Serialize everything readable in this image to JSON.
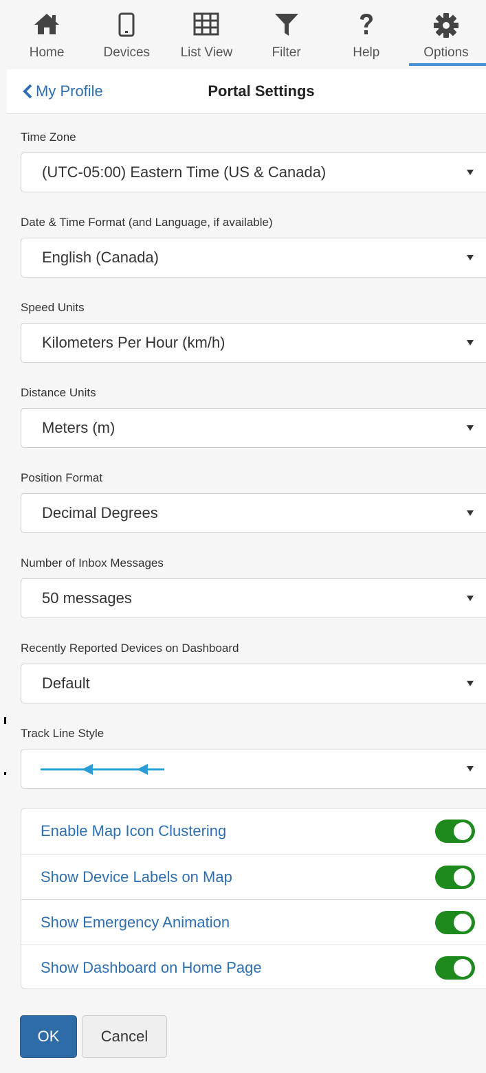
{
  "nav": {
    "items": [
      {
        "label": "Home",
        "icon": "home-icon"
      },
      {
        "label": "Devices",
        "icon": "device-icon"
      },
      {
        "label": "List View",
        "icon": "grid-icon"
      },
      {
        "label": "Filter",
        "icon": "filter-icon"
      },
      {
        "label": "Help",
        "icon": "help-icon"
      },
      {
        "label": "Options",
        "icon": "gear-icon",
        "active": true
      }
    ]
  },
  "header": {
    "back_label": "My Profile",
    "title": "Portal Settings"
  },
  "fields": [
    {
      "label": "Time Zone",
      "value": "(UTC-05:00) Eastern Time (US & Canada)"
    },
    {
      "label": "Date & Time Format (and Language, if available)",
      "value": "English (Canada)"
    },
    {
      "label": "Speed Units",
      "value": "Kilometers Per Hour (km/h)"
    },
    {
      "label": "Distance Units",
      "value": "Meters (m)"
    },
    {
      "label": "Position Format",
      "value": "Decimal Degrees"
    },
    {
      "label": "Number of Inbox Messages",
      "value": "50 messages"
    },
    {
      "label": "Recently Reported Devices on Dashboard",
      "value": "Default"
    },
    {
      "label": "Track Line Style",
      "value": "",
      "icon": "track-line-arrows-icon"
    }
  ],
  "toggles": [
    {
      "label": "Enable Map Icon Clustering",
      "on": true
    },
    {
      "label": "Show Device Labels on Map",
      "on": true
    },
    {
      "label": "Show Emergency Animation",
      "on": true
    },
    {
      "label": "Show Dashboard on Home Page",
      "on": true
    }
  ],
  "buttons": {
    "ok": "OK",
    "cancel": "Cancel"
  },
  "colors": {
    "link": "#2e6fb2",
    "toggle_on": "#1e8a1e",
    "primary_button": "#2e6ca8",
    "active_tab_underline": "#4a90d9",
    "track_line": "#2a9fd6"
  }
}
